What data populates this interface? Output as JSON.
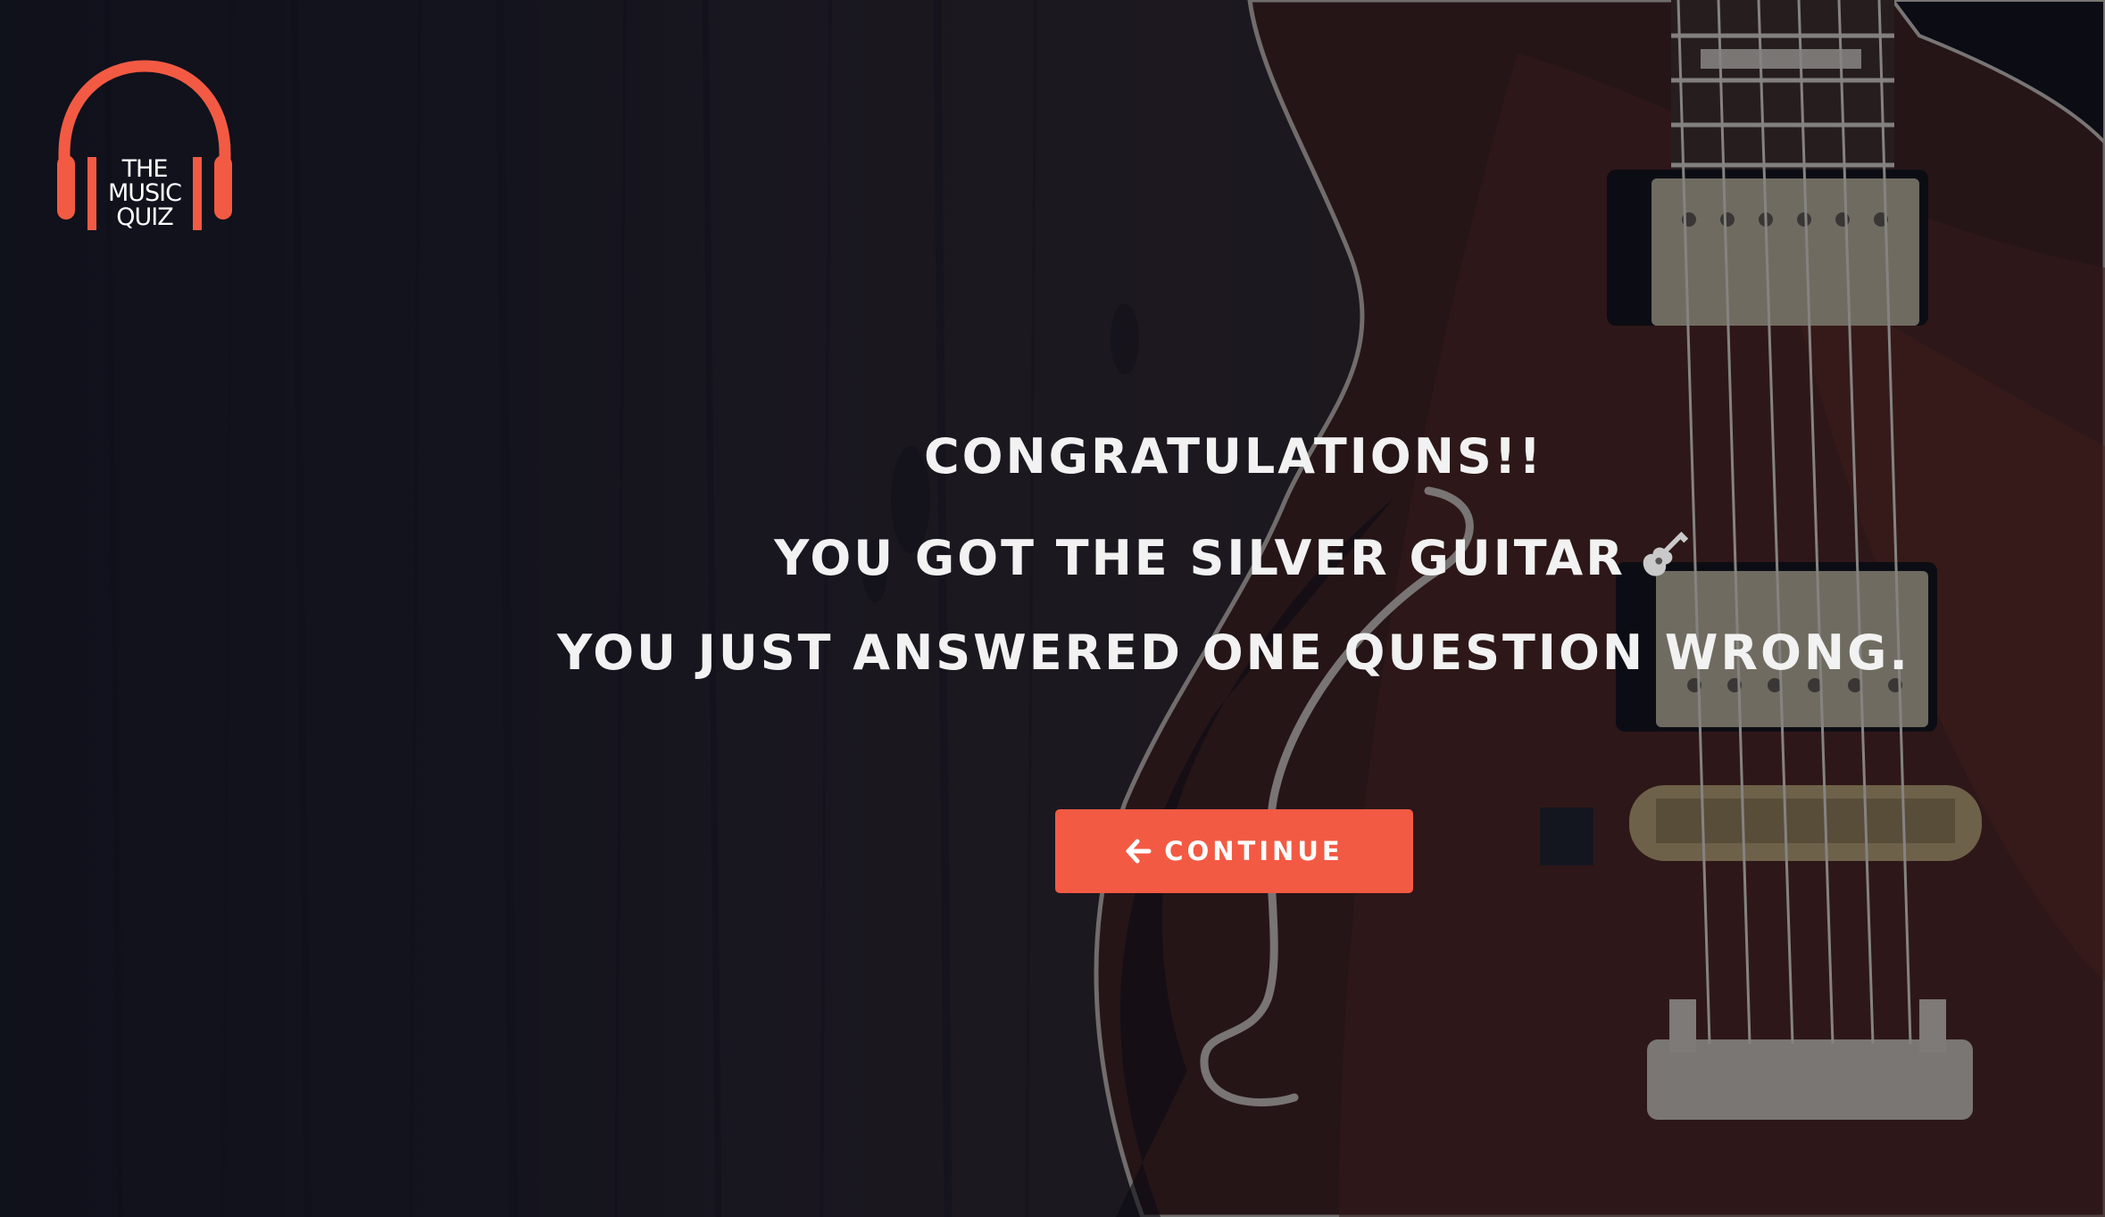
{
  "app": {
    "logo_lines": [
      "THE",
      "MUSIC",
      "QUIZ"
    ]
  },
  "result": {
    "heading": "CONGRATULATIONS!!",
    "award_text": "YOU GOT THE SILVER GUITAR",
    "award_icon": "guitar-icon",
    "detail": "YOU JUST ANSWERED ONE QUESTION WRONG."
  },
  "actions": {
    "continue_label": "CONTINUE",
    "continue_icon": "arrow-left-icon"
  },
  "colors": {
    "accent": "#f35a43",
    "text": "#f2f2f2"
  }
}
